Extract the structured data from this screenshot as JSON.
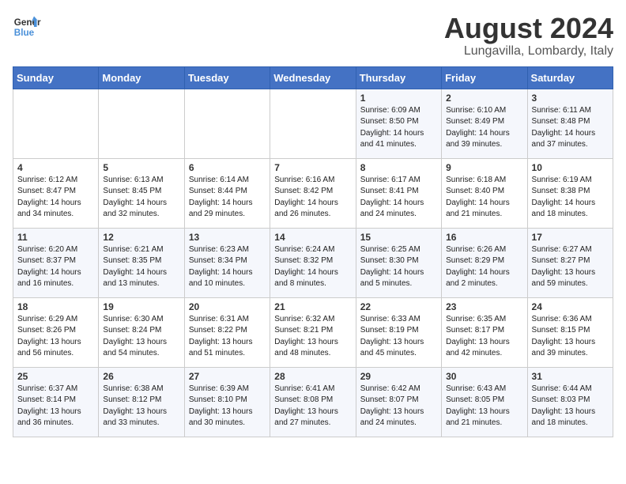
{
  "logo": {
    "line1": "General",
    "line2": "Blue"
  },
  "title": "August 2024",
  "subtitle": "Lungavilla, Lombardy, Italy",
  "days_of_week": [
    "Sunday",
    "Monday",
    "Tuesday",
    "Wednesday",
    "Thursday",
    "Friday",
    "Saturday"
  ],
  "weeks": [
    [
      {
        "day": "",
        "info": ""
      },
      {
        "day": "",
        "info": ""
      },
      {
        "day": "",
        "info": ""
      },
      {
        "day": "",
        "info": ""
      },
      {
        "day": "1",
        "info": "Sunrise: 6:09 AM\nSunset: 8:50 PM\nDaylight: 14 hours and 41 minutes."
      },
      {
        "day": "2",
        "info": "Sunrise: 6:10 AM\nSunset: 8:49 PM\nDaylight: 14 hours and 39 minutes."
      },
      {
        "day": "3",
        "info": "Sunrise: 6:11 AM\nSunset: 8:48 PM\nDaylight: 14 hours and 37 minutes."
      }
    ],
    [
      {
        "day": "4",
        "info": "Sunrise: 6:12 AM\nSunset: 8:47 PM\nDaylight: 14 hours and 34 minutes."
      },
      {
        "day": "5",
        "info": "Sunrise: 6:13 AM\nSunset: 8:45 PM\nDaylight: 14 hours and 32 minutes."
      },
      {
        "day": "6",
        "info": "Sunrise: 6:14 AM\nSunset: 8:44 PM\nDaylight: 14 hours and 29 minutes."
      },
      {
        "day": "7",
        "info": "Sunrise: 6:16 AM\nSunset: 8:42 PM\nDaylight: 14 hours and 26 minutes."
      },
      {
        "day": "8",
        "info": "Sunrise: 6:17 AM\nSunset: 8:41 PM\nDaylight: 14 hours and 24 minutes."
      },
      {
        "day": "9",
        "info": "Sunrise: 6:18 AM\nSunset: 8:40 PM\nDaylight: 14 hours and 21 minutes."
      },
      {
        "day": "10",
        "info": "Sunrise: 6:19 AM\nSunset: 8:38 PM\nDaylight: 14 hours and 18 minutes."
      }
    ],
    [
      {
        "day": "11",
        "info": "Sunrise: 6:20 AM\nSunset: 8:37 PM\nDaylight: 14 hours and 16 minutes."
      },
      {
        "day": "12",
        "info": "Sunrise: 6:21 AM\nSunset: 8:35 PM\nDaylight: 14 hours and 13 minutes."
      },
      {
        "day": "13",
        "info": "Sunrise: 6:23 AM\nSunset: 8:34 PM\nDaylight: 14 hours and 10 minutes."
      },
      {
        "day": "14",
        "info": "Sunrise: 6:24 AM\nSunset: 8:32 PM\nDaylight: 14 hours and 8 minutes."
      },
      {
        "day": "15",
        "info": "Sunrise: 6:25 AM\nSunset: 8:30 PM\nDaylight: 14 hours and 5 minutes."
      },
      {
        "day": "16",
        "info": "Sunrise: 6:26 AM\nSunset: 8:29 PM\nDaylight: 14 hours and 2 minutes."
      },
      {
        "day": "17",
        "info": "Sunrise: 6:27 AM\nSunset: 8:27 PM\nDaylight: 13 hours and 59 minutes."
      }
    ],
    [
      {
        "day": "18",
        "info": "Sunrise: 6:29 AM\nSunset: 8:26 PM\nDaylight: 13 hours and 56 minutes."
      },
      {
        "day": "19",
        "info": "Sunrise: 6:30 AM\nSunset: 8:24 PM\nDaylight: 13 hours and 54 minutes."
      },
      {
        "day": "20",
        "info": "Sunrise: 6:31 AM\nSunset: 8:22 PM\nDaylight: 13 hours and 51 minutes."
      },
      {
        "day": "21",
        "info": "Sunrise: 6:32 AM\nSunset: 8:21 PM\nDaylight: 13 hours and 48 minutes."
      },
      {
        "day": "22",
        "info": "Sunrise: 6:33 AM\nSunset: 8:19 PM\nDaylight: 13 hours and 45 minutes."
      },
      {
        "day": "23",
        "info": "Sunrise: 6:35 AM\nSunset: 8:17 PM\nDaylight: 13 hours and 42 minutes."
      },
      {
        "day": "24",
        "info": "Sunrise: 6:36 AM\nSunset: 8:15 PM\nDaylight: 13 hours and 39 minutes."
      }
    ],
    [
      {
        "day": "25",
        "info": "Sunrise: 6:37 AM\nSunset: 8:14 PM\nDaylight: 13 hours and 36 minutes."
      },
      {
        "day": "26",
        "info": "Sunrise: 6:38 AM\nSunset: 8:12 PM\nDaylight: 13 hours and 33 minutes."
      },
      {
        "day": "27",
        "info": "Sunrise: 6:39 AM\nSunset: 8:10 PM\nDaylight: 13 hours and 30 minutes."
      },
      {
        "day": "28",
        "info": "Sunrise: 6:41 AM\nSunset: 8:08 PM\nDaylight: 13 hours and 27 minutes."
      },
      {
        "day": "29",
        "info": "Sunrise: 6:42 AM\nSunset: 8:07 PM\nDaylight: 13 hours and 24 minutes."
      },
      {
        "day": "30",
        "info": "Sunrise: 6:43 AM\nSunset: 8:05 PM\nDaylight: 13 hours and 21 minutes."
      },
      {
        "day": "31",
        "info": "Sunrise: 6:44 AM\nSunset: 8:03 PM\nDaylight: 13 hours and 18 minutes."
      }
    ]
  ]
}
